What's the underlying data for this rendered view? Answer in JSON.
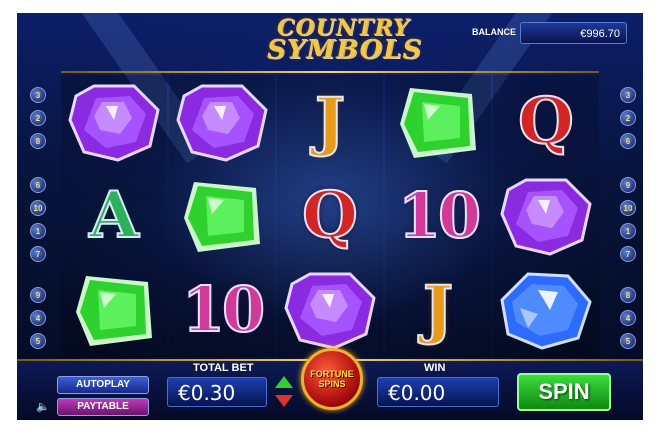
{
  "game": {
    "logo_line1": "COUNTRY",
    "logo_line2": "SYMBOLS"
  },
  "balance": {
    "label": "BALANCE",
    "value": "€996.70"
  },
  "reels": [
    [
      "purple-gem",
      "letter-a",
      "green-gem"
    ],
    [
      "purple-gem",
      "green-gem",
      "letter-10"
    ],
    [
      "letter-j",
      "letter-q",
      "purple-gem"
    ],
    [
      "green-gem",
      "letter-10",
      "letter-j"
    ],
    [
      "letter-q",
      "purple-gem",
      "blue-diamond"
    ]
  ],
  "symbol_text": {
    "letter-a": "A",
    "letter-j": "J",
    "letter-q": "Q",
    "letter-10": "10"
  },
  "paylines_left": [
    "3",
    "2",
    "8",
    "6",
    "10",
    "1",
    "7",
    "9",
    "4",
    "5"
  ],
  "paylines_right": [
    "3",
    "2",
    "6",
    "9",
    "10",
    "1",
    "7",
    "8",
    "4",
    "5"
  ],
  "controls": {
    "autoplay": "AUTOPLAY",
    "paytable": "PAYTABLE",
    "total_bet_label": "TOTAL BET",
    "total_bet_value": "€0.30",
    "fortune_line1": "FORTUNE",
    "fortune_line2": "SPINS",
    "win_label": "WIN",
    "win_value": "€0.00",
    "spin": "SPIN"
  },
  "colors": {
    "purple_gem": "#8a2be2",
    "green_gem": "#2ed12e",
    "blue_diamond": "#2d6bff",
    "spin_button": "#2cc42c"
  }
}
